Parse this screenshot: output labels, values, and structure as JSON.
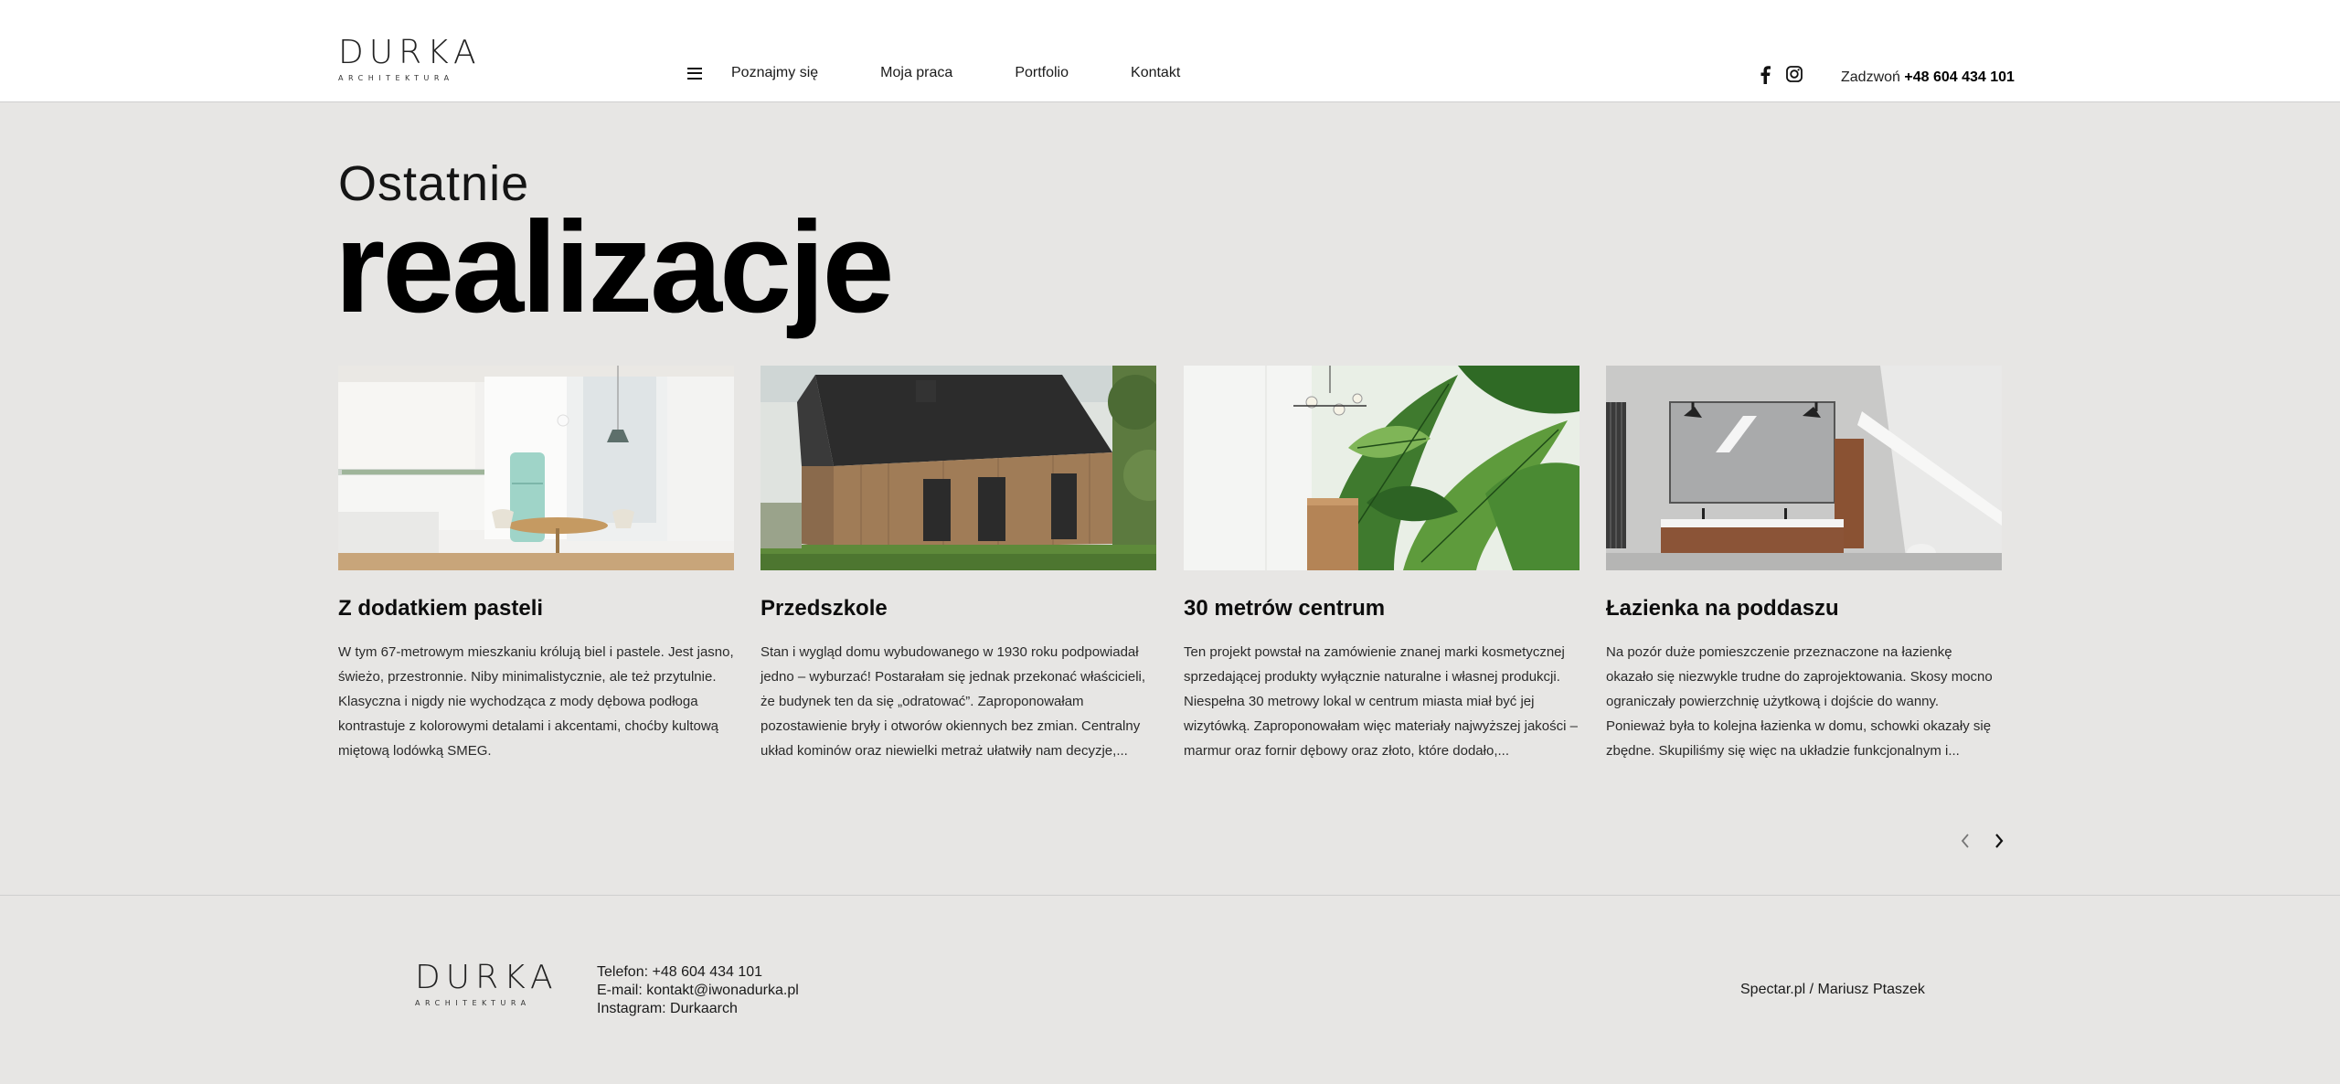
{
  "brand": {
    "logo_text": "DURKA",
    "logo_sub": "ARCHITEKTURA"
  },
  "nav": {
    "menu_icon": "hamburger-icon",
    "items": [
      {
        "label": "Poznajmy się"
      },
      {
        "label": "Moja praca"
      },
      {
        "label": "Portfolio"
      },
      {
        "label": "Kontakt"
      }
    ]
  },
  "social": {
    "facebook_icon": "facebook-icon",
    "instagram_icon": "instagram-icon"
  },
  "phone": {
    "prefix": "Zadzwoń",
    "number": "+48 604 434 101"
  },
  "section": {
    "title_small": "Ostatnie",
    "title_big": "realizacje"
  },
  "projects": [
    {
      "image": "kitchen-interior-photo",
      "title": "Z dodatkiem pasteli",
      "desc": "W tym 67-metrowym mieszkaniu królują biel i pastele. Jest jasno, świeżo, przestronnie. Niby minimalistycznie, ale też przytulnie. Klasyczna i nigdy nie wychodząca z mody dębowa podłoga kontrastuje z kolorowymi detalami i akcentami, choćby kultową miętową lodówką SMEG."
    },
    {
      "image": "wooden-house-photo",
      "title": "Przedszkole",
      "desc": "Stan i wygląd domu wybudowanego w 1930 roku podpowiadał jedno – wyburzać! Postarałam się jednak przekonać właścicieli, że budynek ten da się „odratować”. Zaproponowałam pozostawienie bryły i otworów okiennych bez zmian. Centralny układ kominów oraz niewielki metraż ułatwiły nam decyzje,..."
    },
    {
      "image": "green-leaves-wall-photo",
      "title": "30 metrów centrum",
      "desc": "Ten projekt powstał na zamówienie znanej marki kosmetycznej sprzedającej produkty wyłącznie naturalne i własnej produkcji. Niespełna 30 metrowy lokal w centrum miasta miał być jej wizytówką. Zaproponowałam więc materiały najwyższej jakości – marmur oraz fornir dębowy oraz złoto, które dodało,..."
    },
    {
      "image": "attic-bathroom-render",
      "title": "Łazienka na poddaszu",
      "desc": "Na pozór duże pomieszczenie przeznaczone na łazienkę okazało się niezwykle trudne do zaprojektowania. Skosy mocno ograniczały powierzchnię użytkową i dojście do wanny. Ponieważ była to kolejna łazienka w domu, schowki okazały się zbędne. Skupiliśmy się więc na układzie funkcjonalnym i..."
    }
  ],
  "slider": {
    "prev_icon": "chevron-left-icon",
    "next_icon": "chevron-right-icon"
  },
  "footer": {
    "phone_line": "Telefon: +48 604 434 101",
    "email_line": "E-mail: kontakt@iwonadurka.pl",
    "instagram_line": "Instagram: Durkaarch",
    "credits": "Spectar.pl / Mariusz Ptaszek"
  },
  "colors": {
    "background": "#e7e6e4",
    "header_bg": "#ffffff",
    "text": "#111111"
  }
}
